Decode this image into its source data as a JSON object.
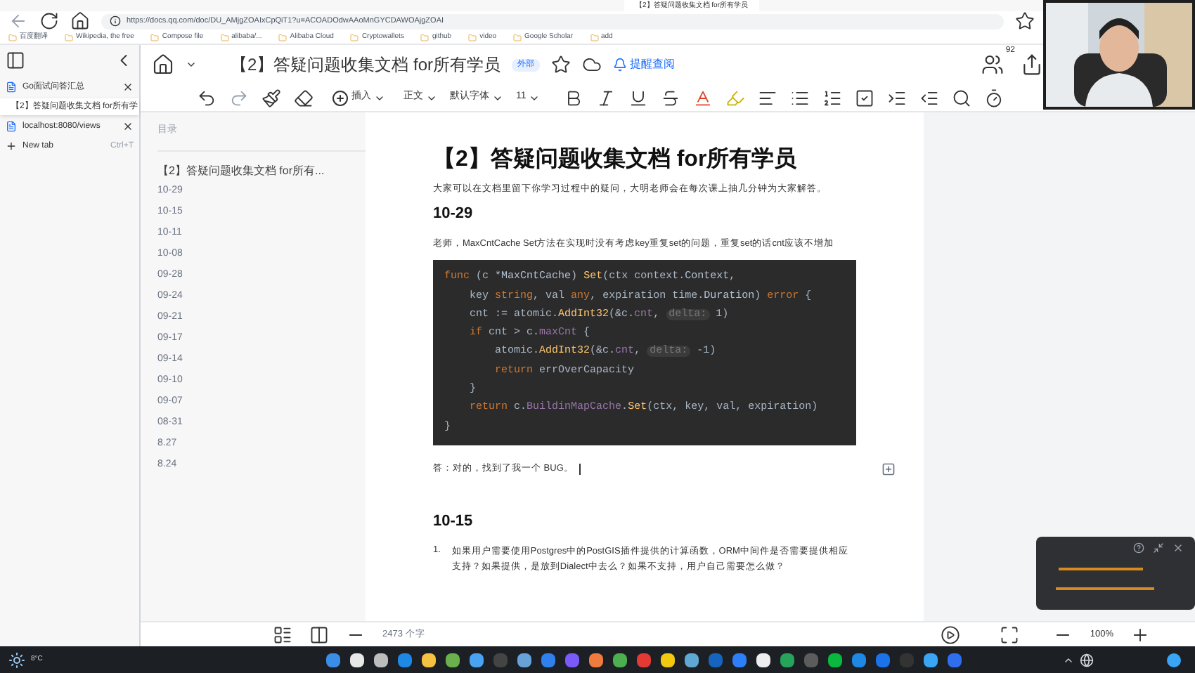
{
  "browser": {
    "tab_title": "【2】答疑问题收集文档 for所有学员",
    "url": "https://docs.qq.com/doc/DU_AMjgZOAIxCpQiT1?u=ACOADOdwAAoMnGYCDAWOAjgZOAI",
    "bookmarks": [
      "百度翻译",
      "Wikipedia, the free",
      "Compose file",
      "alibaba/...",
      "Alibaba Cloud",
      "Cryptowallets",
      "github",
      "video",
      "Google Scholar",
      "add"
    ]
  },
  "vertical_tabs": [
    {
      "title": "Go面试问答汇总",
      "selected": false
    },
    {
      "title": "【2】答疑问题收集文档 for所有学",
      "selected": true
    },
    {
      "title": "localhost:8080/views",
      "selected": false
    }
  ],
  "new_tab": {
    "label": "New tab",
    "shortcut": "Ctrl+T"
  },
  "doc_header": {
    "title": "【2】答疑问题收集文档 for所有学员",
    "badge": "外部",
    "link": "提醒查阅",
    "collaborators": "92"
  },
  "toolbar": {
    "insert": "插入",
    "style": "正文",
    "font": "默认字体",
    "size": "11"
  },
  "outline": {
    "title": "目录",
    "items": [
      {
        "label": "【2】答疑问题收集文档 for所有...",
        "selected": true
      },
      {
        "label": "10-29",
        "selected": false
      },
      {
        "label": "10-15",
        "selected": false
      },
      {
        "label": "10-11",
        "selected": false
      },
      {
        "label": "10-08",
        "selected": false
      },
      {
        "label": "09-28",
        "selected": false
      },
      {
        "label": "09-24",
        "selected": false
      },
      {
        "label": "09-21",
        "selected": false
      },
      {
        "label": "09-17",
        "selected": false
      },
      {
        "label": "09-14",
        "selected": false
      },
      {
        "label": "09-10",
        "selected": false
      },
      {
        "label": "09-07",
        "selected": false
      },
      {
        "label": "08-31",
        "selected": false
      },
      {
        "label": "8.27",
        "selected": false
      },
      {
        "label": "8.24",
        "selected": false
      }
    ]
  },
  "document": {
    "title": "【2】答疑问题收集文档 for所有学员",
    "intro": "大家可以在文档里留下你学习过程中的疑问，大明老师会在每次课上抽几分钟为大家解答。",
    "sections": [
      {
        "heading": "10-29",
        "question": "老师，MaxCntCache Set方法在实现时没有考虑key重复set的问题，重复set的话cnt应该不增加",
        "code": [
          {
            "tokens": [
              {
                "kind": "keyword",
                "text": "func "
              },
              {
                "kind": "plain",
                "text": "(c *"
              },
              {
                "kind": "type",
                "text": "MaxCntCache"
              },
              {
                "kind": "plain",
                "text": ") "
              },
              {
                "kind": "func",
                "text": "Set"
              },
              {
                "kind": "plain",
                "text": "(ctx context."
              },
              {
                "kind": "type",
                "text": "Context"
              },
              {
                "kind": "plain",
                "text": ","
              }
            ],
            "children": [
              {
                "tokens": [
                  {
                    "kind": "plain",
                    "text": "key "
                  },
                  {
                    "kind": "keyword",
                    "text": "string"
                  },
                  {
                    "kind": "plain",
                    "text": ", val "
                  },
                  {
                    "kind": "keyword",
                    "text": "any"
                  },
                  {
                    "kind": "plain",
                    "text": ", expiration time."
                  },
                  {
                    "kind": "type",
                    "text": "Duration"
                  },
                  {
                    "kind": "plain",
                    "text": ") "
                  },
                  {
                    "kind": "keyword",
                    "text": "error"
                  },
                  {
                    "kind": "plain",
                    "text": " {"
                  }
                ]
              },
              {
                "tokens": [
                  {
                    "kind": "plain",
                    "text": "cnt := atomic."
                  },
                  {
                    "kind": "func",
                    "text": "AddInt32"
                  },
                  {
                    "kind": "plain",
                    "text": "(&c."
                  },
                  {
                    "kind": "field",
                    "text": "cnt"
                  },
                  {
                    "kind": "plain",
                    "text": ", "
                  },
                  {
                    "kind": "hint",
                    "text": "delta:"
                  },
                  {
                    "kind": "plain",
                    "text": " 1)"
                  }
                ]
              },
              {
                "tokens": [
                  {
                    "kind": "keyword",
                    "text": "if"
                  },
                  {
                    "kind": "plain",
                    "text": " cnt > c."
                  },
                  {
                    "kind": "field",
                    "text": "maxCnt"
                  },
                  {
                    "kind": "plain",
                    "text": " {"
                  }
                ],
                "children": [
                  {
                    "tokens": [
                      {
                        "kind": "plain",
                        "text": "atomic."
                      },
                      {
                        "kind": "func",
                        "text": "AddInt32"
                      },
                      {
                        "kind": "plain",
                        "text": "(&c."
                      },
                      {
                        "kind": "field",
                        "text": "cnt"
                      },
                      {
                        "kind": "plain",
                        "text": ", "
                      },
                      {
                        "kind": "hint",
                        "text": "delta:"
                      },
                      {
                        "kind": "plain",
                        "text": " -1)"
                      }
                    ]
                  },
                  {
                    "tokens": [
                      {
                        "kind": "keyword",
                        "text": "return"
                      },
                      {
                        "kind": "plain",
                        "text": " errOverCapacity"
                      }
                    ]
                  }
                ]
              },
              {
                "tokens": [
                  {
                    "kind": "plain",
                    "text": "}"
                  }
                ]
              },
              {
                "tokens": [
                  {
                    "kind": "keyword",
                    "text": "return"
                  },
                  {
                    "kind": "plain",
                    "text": " c."
                  },
                  {
                    "kind": "field",
                    "text": "BuildinMapCache"
                  },
                  {
                    "kind": "plain",
                    "text": "."
                  },
                  {
                    "kind": "func",
                    "text": "Set"
                  },
                  {
                    "kind": "plain",
                    "text": "(ctx, key, val, expiration)"
                  }
                ]
              }
            ]
          },
          {
            "tokens": [
              {
                "kind": "plain",
                "text": "}"
              }
            ]
          }
        ],
        "answer": "答：对的，找到了我一个 BUG。"
      },
      {
        "heading": "10-15",
        "list": [
          {
            "number": "1.",
            "text": "如果用户需要使用Postgres中的PostGIS插件提供的计算函数，ORM中间件是否需要提供相应支持？如果提供，是放到Dialect中去么？如果不支持，用户自己需要怎么做？"
          }
        ]
      }
    ]
  },
  "status_bar": {
    "word_count": "2473 个字",
    "zoom": "100%"
  },
  "taskbar": {
    "temperature": "8°C"
  }
}
